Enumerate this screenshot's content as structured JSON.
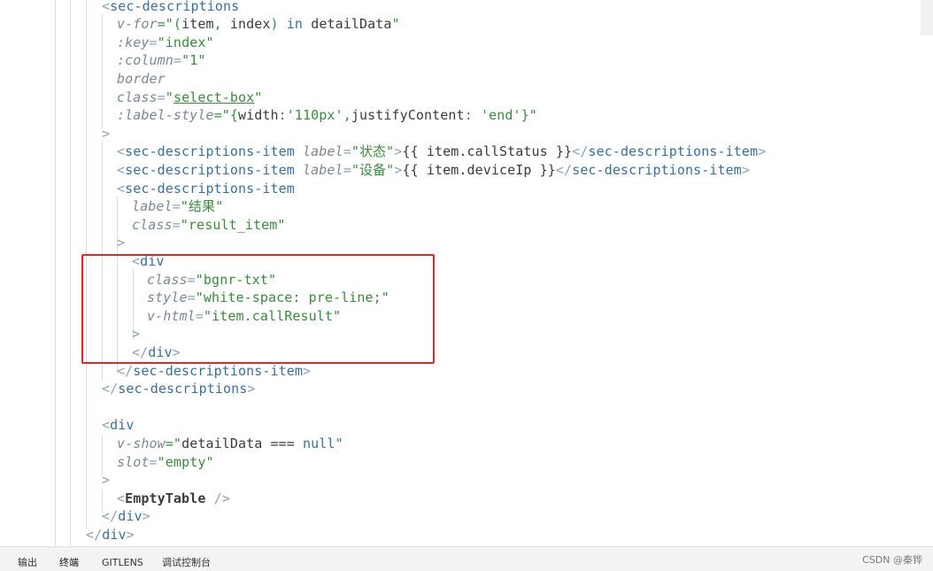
{
  "editor": {
    "lines": [
      {
        "tokens": [
          {
            "t": "<",
            "c": "punc"
          },
          {
            "t": "sec-descriptions",
            "c": "tag"
          }
        ]
      },
      {
        "tokens": [
          {
            "t": "v-for",
            "c": "attr"
          },
          {
            "t": "=\"(",
            "c": "str"
          },
          {
            "t": "item",
            "c": "var"
          },
          {
            "t": ", ",
            "c": "str"
          },
          {
            "t": "index",
            "c": "var"
          },
          {
            "t": ") ",
            "c": "str"
          },
          {
            "t": "in",
            "c": "kw"
          },
          {
            "t": " ",
            "c": "str"
          },
          {
            "t": "detailData",
            "c": "var"
          },
          {
            "t": "\"",
            "c": "str"
          }
        ]
      },
      {
        "tokens": [
          {
            "t": ":key",
            "c": "attr"
          },
          {
            "t": "=",
            "c": "punc"
          },
          {
            "t": "\"index\"",
            "c": "str"
          }
        ]
      },
      {
        "tokens": [
          {
            "t": ":column",
            "c": "attr"
          },
          {
            "t": "=",
            "c": "punc"
          },
          {
            "t": "\"1\"",
            "c": "str"
          }
        ]
      },
      {
        "tokens": [
          {
            "t": "border",
            "c": "attr"
          }
        ]
      },
      {
        "tokens": [
          {
            "t": "class",
            "c": "attr"
          },
          {
            "t": "=",
            "c": "punc"
          },
          {
            "t": "\"",
            "c": "str"
          },
          {
            "t": "select-box",
            "c": "strul"
          },
          {
            "t": "\"",
            "c": "str"
          }
        ]
      },
      {
        "tokens": [
          {
            "t": ":label-style",
            "c": "attr"
          },
          {
            "t": "=\"{",
            "c": "str"
          },
          {
            "t": "width",
            "c": "var"
          },
          {
            "t": ":",
            "c": "str"
          },
          {
            "t": "'110px'",
            "c": "str"
          },
          {
            "t": ",",
            "c": "str"
          },
          {
            "t": "justifyContent",
            "c": "var"
          },
          {
            "t": ": ",
            "c": "str"
          },
          {
            "t": "'end'",
            "c": "str"
          },
          {
            "t": "}\"",
            "c": "str"
          }
        ]
      },
      {
        "tokens": [
          {
            "t": ">",
            "c": "punc"
          }
        ]
      },
      {
        "tokens": [
          {
            "t": "<",
            "c": "punc"
          },
          {
            "t": "sec-descriptions-item",
            "c": "tag"
          },
          {
            "t": " ",
            "c": "punc"
          },
          {
            "t": "label",
            "c": "attr"
          },
          {
            "t": "=",
            "c": "punc"
          },
          {
            "t": "\"状态\"",
            "c": "str"
          },
          {
            "t": ">",
            "c": "punc"
          },
          {
            "t": "{{ item.callStatus }}",
            "c": "var"
          },
          {
            "t": "</",
            "c": "punc"
          },
          {
            "t": "sec-descriptions-item",
            "c": "tag"
          },
          {
            "t": ">",
            "c": "punc"
          }
        ]
      },
      {
        "tokens": [
          {
            "t": "<",
            "c": "punc"
          },
          {
            "t": "sec-descriptions-item",
            "c": "tag"
          },
          {
            "t": " ",
            "c": "punc"
          },
          {
            "t": "label",
            "c": "attr"
          },
          {
            "t": "=",
            "c": "punc"
          },
          {
            "t": "\"设备\"",
            "c": "str"
          },
          {
            "t": ">",
            "c": "punc"
          },
          {
            "t": "{{ item.deviceIp }}",
            "c": "var"
          },
          {
            "t": "</",
            "c": "punc"
          },
          {
            "t": "sec-descriptions-item",
            "c": "tag"
          },
          {
            "t": ">",
            "c": "punc"
          }
        ]
      },
      {
        "tokens": [
          {
            "t": "<",
            "c": "punc"
          },
          {
            "t": "sec-descriptions-item",
            "c": "tag"
          }
        ]
      },
      {
        "tokens": [
          {
            "t": "label",
            "c": "attr"
          },
          {
            "t": "=",
            "c": "punc"
          },
          {
            "t": "\"结果\"",
            "c": "str"
          }
        ]
      },
      {
        "tokens": [
          {
            "t": "class",
            "c": "attr"
          },
          {
            "t": "=",
            "c": "punc"
          },
          {
            "t": "\"result_item\"",
            "c": "str"
          }
        ]
      },
      {
        "tokens": [
          {
            "t": ">",
            "c": "punc"
          }
        ]
      },
      {
        "tokens": [
          {
            "t": "<",
            "c": "punc"
          },
          {
            "t": "div",
            "c": "tag"
          }
        ]
      },
      {
        "tokens": [
          {
            "t": "class",
            "c": "attr"
          },
          {
            "t": "=",
            "c": "punc"
          },
          {
            "t": "\"bgnr-txt\"",
            "c": "str"
          }
        ]
      },
      {
        "tokens": [
          {
            "t": "style",
            "c": "attr"
          },
          {
            "t": "=",
            "c": "punc"
          },
          {
            "t": "\"white-space: pre-line;\"",
            "c": "str"
          }
        ]
      },
      {
        "tokens": [
          {
            "t": "v-html",
            "c": "attr"
          },
          {
            "t": "=",
            "c": "punc"
          },
          {
            "t": "\"item.callResult\"",
            "c": "str"
          }
        ]
      },
      {
        "tokens": [
          {
            "t": ">",
            "c": "punc"
          }
        ]
      },
      {
        "tokens": [
          {
            "t": "</",
            "c": "punc"
          },
          {
            "t": "div",
            "c": "tag"
          },
          {
            "t": ">",
            "c": "punc"
          }
        ]
      },
      {
        "tokens": [
          {
            "t": "</",
            "c": "punc"
          },
          {
            "t": "sec-descriptions-item",
            "c": "tag"
          },
          {
            "t": ">",
            "c": "punc"
          }
        ]
      },
      {
        "tokens": [
          {
            "t": "</",
            "c": "punc"
          },
          {
            "t": "sec-descriptions",
            "c": "tag"
          },
          {
            "t": ">",
            "c": "punc"
          }
        ]
      },
      {
        "tokens": []
      },
      {
        "tokens": [
          {
            "t": "<",
            "c": "punc"
          },
          {
            "t": "div",
            "c": "tag"
          }
        ]
      },
      {
        "tokens": [
          {
            "t": "v-show",
            "c": "attr"
          },
          {
            "t": "=\"",
            "c": "str"
          },
          {
            "t": "detailData",
            "c": "var"
          },
          {
            "t": " === ",
            "c": "op"
          },
          {
            "t": "null",
            "c": "kw"
          },
          {
            "t": "\"",
            "c": "str"
          }
        ]
      },
      {
        "tokens": [
          {
            "t": "slot",
            "c": "attr"
          },
          {
            "t": "=",
            "c": "punc"
          },
          {
            "t": "\"empty\"",
            "c": "str"
          }
        ]
      },
      {
        "tokens": [
          {
            "t": ">",
            "c": "punc"
          }
        ]
      },
      {
        "tokens": [
          {
            "t": "<",
            "c": "punc"
          },
          {
            "t": "EmptyTable",
            "c": "comp"
          },
          {
            "t": " />",
            "c": "punc"
          }
        ]
      },
      {
        "tokens": [
          {
            "t": "</",
            "c": "punc"
          },
          {
            "t": "div",
            "c": "tag"
          },
          {
            "t": ">",
            "c": "punc"
          }
        ]
      },
      {
        "tokens": [
          {
            "t": "</",
            "c": "punc"
          },
          {
            "t": "div",
            "c": "tag"
          },
          {
            "t": ">",
            "c": "punc"
          }
        ]
      }
    ]
  },
  "panel": {
    "tabs": [
      {
        "label": "输出",
        "active": false
      },
      {
        "label": "终端",
        "active": true
      },
      {
        "label": "GITLENS",
        "active": false
      },
      {
        "label": "调试控制台",
        "active": false
      }
    ]
  },
  "watermark": "CSDN @秦铧",
  "colors": {
    "highlight_box": "#e02a2a",
    "tag": "#3a6f9c",
    "string": "#3b8a3e",
    "attribute": "#7b8793",
    "punctuation": "#8ea1b8"
  }
}
